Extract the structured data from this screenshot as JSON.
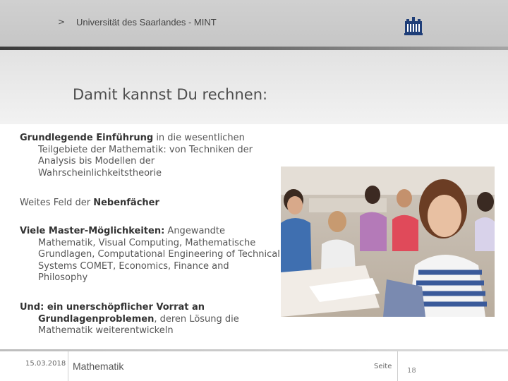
{
  "header": {
    "breadcrumb_arrow": ">",
    "institution": "Universität des Saarlandes - MINT",
    "logo_icon": "university-crest-icon"
  },
  "slide": {
    "title": "Damit kannst Du rechnen:",
    "paragraphs": [
      {
        "bold": "Grundlegende Einführung",
        "text": " in die wesentlichen Teilgebiete der Mathematik: von Techniken der Analysis bis Modellen der Wahrscheinlichkeitstheorie"
      },
      {
        "lead": "Weites Feld der ",
        "bold": "Nebenfächer"
      },
      {
        "bold": "Viele Master-Möglichkeiten:",
        "text": " Angewandte Mathematik, Visual Computing, Mathematische Grundlagen, Computational Engineering of Technical Systems COMET, Economics, Finance and Philosophy"
      },
      {
        "bold": "Und: ein unerschöpflicher Vorrat an Grundlagenproblemen",
        "text": ", deren Lösung die Mathematik weiterentwickeln"
      }
    ],
    "photo_icon": "students-classroom-photo"
  },
  "footer": {
    "date": "15.03.2018",
    "subject": "Mathematik",
    "page_label": "Seite",
    "page_number": "18"
  },
  "colors": {
    "header_bg": "#c9c9c9",
    "band_bg": "#ebebeb",
    "text": "#555555"
  }
}
